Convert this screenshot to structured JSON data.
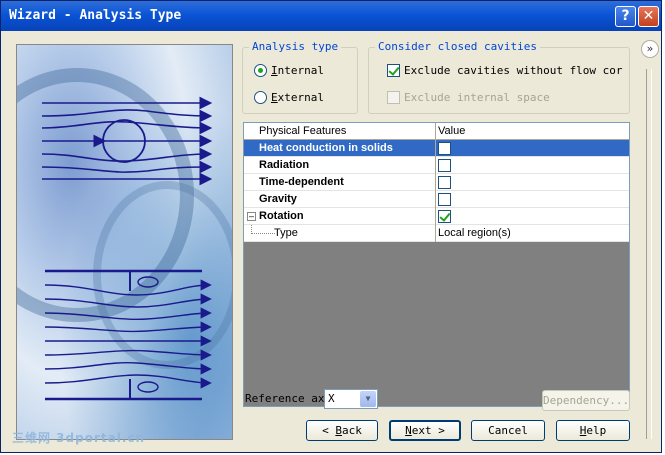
{
  "window": {
    "title": "Wizard - Analysis Type",
    "help_button": "?",
    "close_button": "✕"
  },
  "analysis_type": {
    "legend": "Analysis type",
    "options": [
      {
        "label": "Internal",
        "selected": true
      },
      {
        "label": "External",
        "selected": false
      }
    ]
  },
  "cavities": {
    "legend": "Consider closed cavities",
    "exclude_no_flow": {
      "label": "Exclude cavities without flow cor",
      "checked": true,
      "enabled": true
    },
    "exclude_internal": {
      "label": "Exclude internal space",
      "checked": false,
      "enabled": false
    }
  },
  "expander_glyph": "»",
  "features_grid": {
    "col_feature": "Physical Features",
    "col_value": "Value",
    "rows": [
      {
        "name": "Heat conduction in solids",
        "checked": false,
        "selected": true
      },
      {
        "name": "Radiation",
        "checked": false,
        "selected": false
      },
      {
        "name": "Time-dependent",
        "checked": false,
        "selected": false
      },
      {
        "name": "Gravity",
        "checked": false,
        "selected": false
      },
      {
        "name": "Rotation",
        "checked": true,
        "selected": false
      }
    ],
    "subrow": {
      "name": "Type",
      "value": "Local region(s)"
    }
  },
  "reference": {
    "label": "Reference axi",
    "value": "X",
    "arrow_glyph": "▼"
  },
  "buttons": {
    "dependency": "Dependency...",
    "back": "< Back",
    "next": "Next >",
    "cancel": "Cancel",
    "help": "Help"
  },
  "watermark": "三维网 3dportal.cn",
  "colors": {
    "title_bar": "#0a54d6",
    "selection": "#316ac5",
    "legend_text": "#0046d5",
    "check": "#21a121"
  }
}
